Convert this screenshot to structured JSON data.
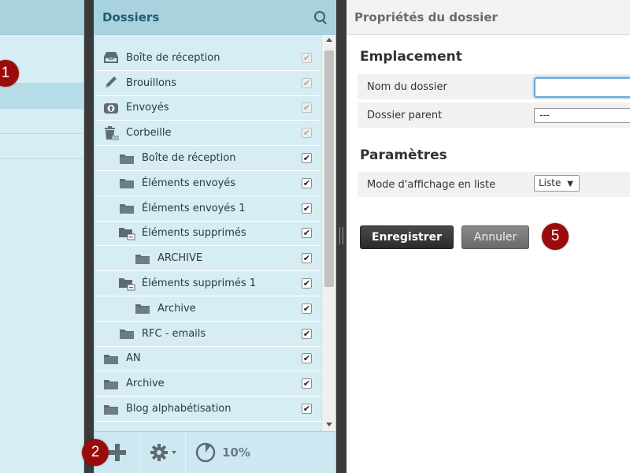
{
  "folders_panel": {
    "title": "Dossiers",
    "items": [
      {
        "label": "Boîte de réception",
        "icon": "inbox-icon",
        "indent": 0,
        "checked": true,
        "disabled": true
      },
      {
        "label": "Brouillons",
        "icon": "pencil-icon",
        "indent": 0,
        "checked": true,
        "disabled": true
      },
      {
        "label": "Envoyés",
        "icon": "sent-icon",
        "indent": 0,
        "checked": true,
        "disabled": true
      },
      {
        "label": "Corbeille",
        "icon": "trash-icon",
        "indent": 0,
        "checked": true,
        "disabled": true
      },
      {
        "label": "Boîte de réception",
        "icon": "folder-icon",
        "indent": 1,
        "checked": true,
        "disabled": false
      },
      {
        "label": "Éléments envoyés",
        "icon": "folder-icon",
        "indent": 1,
        "checked": true,
        "disabled": false
      },
      {
        "label": "Éléments envoyés 1",
        "icon": "folder-icon",
        "indent": 1,
        "checked": true,
        "disabled": false
      },
      {
        "label": "Éléments supprimés",
        "icon": "folder-collapse-icon",
        "indent": 1,
        "checked": true,
        "disabled": false
      },
      {
        "label": "ARCHIVE",
        "icon": "folder-icon",
        "indent": 2,
        "checked": true,
        "disabled": false
      },
      {
        "label": "Éléments supprimés 1",
        "icon": "folder-collapse-icon",
        "indent": 1,
        "checked": true,
        "disabled": false
      },
      {
        "label": "Archive",
        "icon": "folder-icon",
        "indent": 2,
        "checked": true,
        "disabled": false
      },
      {
        "label": "RFC - emails",
        "icon": "folder-icon",
        "indent": 1,
        "checked": true,
        "disabled": false
      },
      {
        "label": "AN",
        "icon": "folder-icon",
        "indent": 0,
        "checked": true,
        "disabled": false
      },
      {
        "label": "Archive",
        "icon": "folder-icon",
        "indent": 0,
        "checked": true,
        "disabled": false
      },
      {
        "label": "Blog alphabétisation",
        "icon": "folder-icon",
        "indent": 0,
        "checked": true,
        "disabled": false
      }
    ],
    "quota": "10%"
  },
  "properties_panel": {
    "title": "Propriétés du dossier",
    "location_section": "Emplacement",
    "folder_name_label": "Nom du dossier",
    "folder_name_value": "",
    "parent_folder_label": "Dossier parent",
    "parent_folder_value": "---",
    "settings_section": "Paramètres",
    "list_mode_label": "Mode d'affichage en liste",
    "list_mode_value": "Liste",
    "save_label": "Enregistrer",
    "cancel_label": "Annuler"
  },
  "badges": {
    "b1": "1",
    "b2": "2",
    "b5": "5"
  },
  "colors": {
    "panel_bg": "#d6edf4",
    "header_bg": "#a8d2de",
    "title_blue": "#1f5c73",
    "badge_red": "#9b0b0b"
  }
}
